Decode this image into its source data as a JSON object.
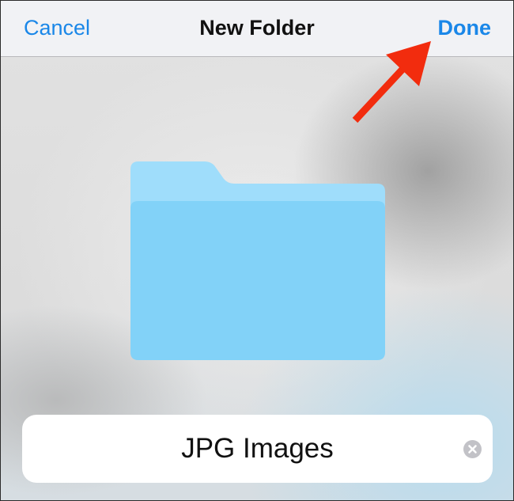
{
  "navbar": {
    "cancel_label": "Cancel",
    "title": "New Folder",
    "done_label": "Done"
  },
  "folder": {
    "icon": "folder-icon",
    "tab_color": "#9fddfb",
    "body_color": "#82d2f8"
  },
  "name_field": {
    "value": "JPG Images",
    "clear_icon": "clear-text-icon"
  },
  "annotation": {
    "icon": "red-arrow-annotation",
    "color": "#f22c0e"
  },
  "colors": {
    "accent": "#1a87e8",
    "title": "#111111"
  }
}
